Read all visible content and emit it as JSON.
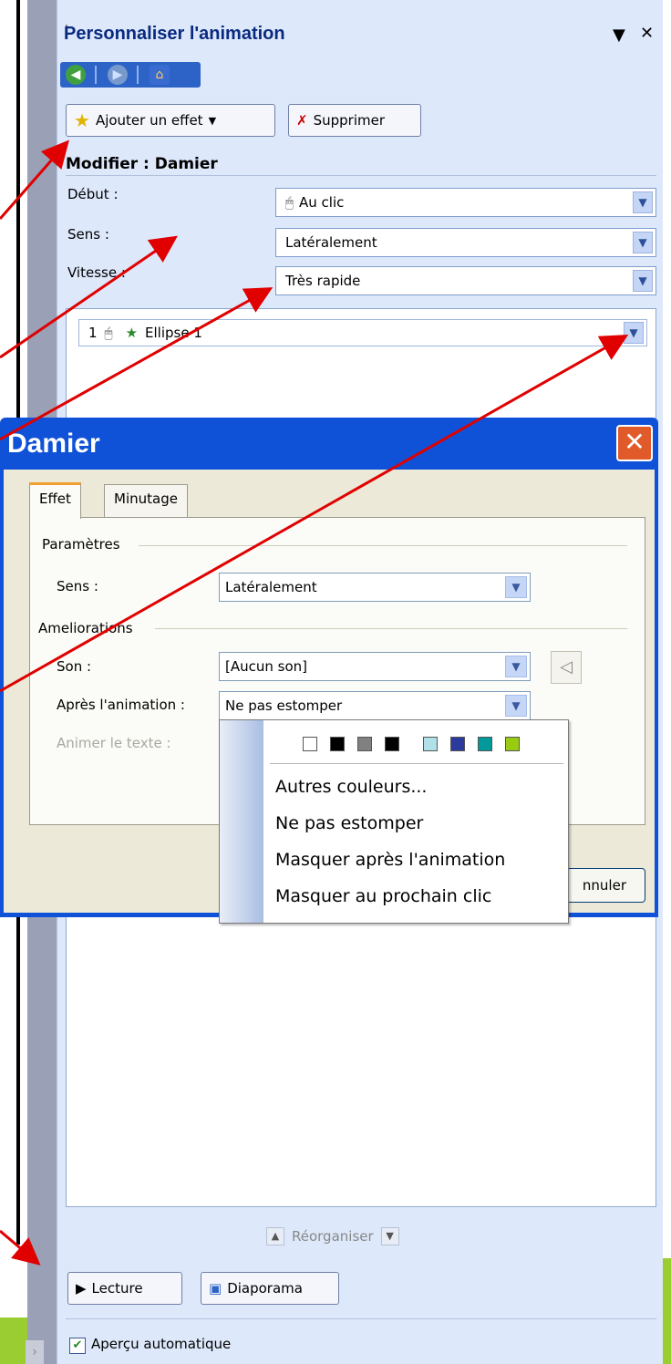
{
  "pane": {
    "title": "Personnaliser l'animation",
    "add_effect": "Ajouter un effet",
    "delete": "Supprimer",
    "modify_title": "Modifier : Damier",
    "start_label": "Début :",
    "start_value": "Au clic",
    "direction_label": "Sens :",
    "direction_value": "Latéralement",
    "speed_label": "Vitesse :",
    "speed_value": "Très rapide",
    "list_item": {
      "number": "1",
      "name": "Ellipse 1"
    },
    "reorder": "Réorganiser",
    "play": "Lecture",
    "slideshow": "Diaporama",
    "auto_preview": "Aperçu automatique"
  },
  "dialog": {
    "title": "Damier",
    "tabs": [
      "Effet",
      "Minutage"
    ],
    "settings_group": "Paramètres",
    "direction_label": "Sens :",
    "direction_value": "Latéralement",
    "enhancements_group": "Ameliorations",
    "sound_label": "Son :",
    "sound_value": "[Aucun son]",
    "after_label": "Après l'animation :",
    "after_value": "Ne pas estomper",
    "animate_text_label": "Animer le texte :",
    "cancel": "nnuler"
  },
  "dropdown": {
    "swatches": [
      "#ffffff",
      "#000000",
      "#808080",
      "#000000",
      "#b0e0e8",
      "#2b3a9c",
      "#009a9a",
      "#99cc11"
    ],
    "items": [
      "Autres couleurs...",
      "Ne pas estomper",
      "Masquer après l'animation",
      "Masquer au prochain clic"
    ]
  },
  "colors": {
    "arrow": "#e00000",
    "title_bar": "#0f52d8",
    "pane_bg": "#dde8fb"
  }
}
